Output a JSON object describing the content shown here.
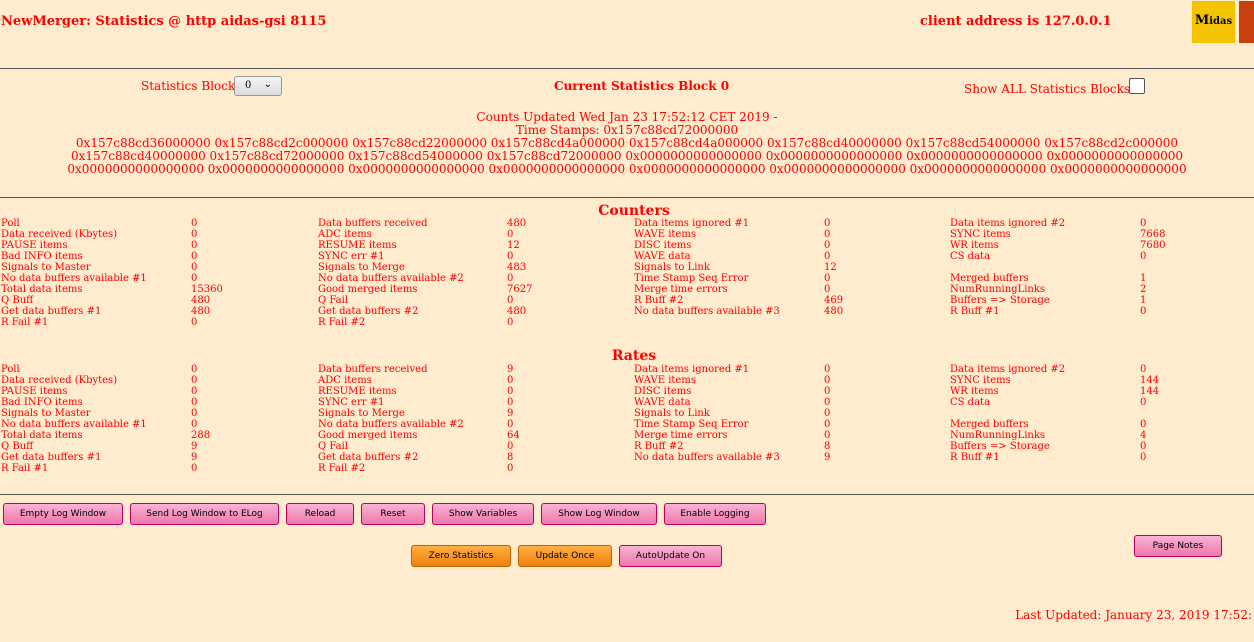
{
  "header": {
    "title": "NewMerger: Statistics @ http aidas-gsi 8115",
    "client": "client address is 127.0.0.1",
    "logo_text": "Midas"
  },
  "controls": {
    "block_label": "Statistics Block",
    "block_value": "0",
    "current": "Current Statistics Block 0",
    "show_all": "Show ALL Statistics Blocks?",
    "show_all_checked": false
  },
  "info": {
    "updated": "Counts Updated Wed Jan 23 17:52:12 CET 2019 -",
    "timestamps_label": "Time Stamps: 0x157c88cd72000000",
    "ts_lines": [
      "0x157c88cd36000000 0x157c88cd2c000000 0x157c88cd22000000 0x157c88cd4a000000 0x157c88cd4a000000 0x157c88cd40000000 0x157c88cd54000000 0x157c88cd2c000000",
      "0x157c88cd40000000 0x157c88cd72000000 0x157c88cd54000000 0x157c88cd72000000 0x0000000000000000 0x0000000000000000 0x0000000000000000 0x0000000000000000",
      "0x0000000000000000 0x0000000000000000 0x0000000000000000 0x0000000000000000 0x0000000000000000 0x0000000000000000 0x0000000000000000 0x0000000000000000"
    ]
  },
  "counters": {
    "title": "Counters",
    "rows": [
      [
        "Poll",
        "0",
        "Data buffers received",
        "480",
        "Data items ignored #1",
        "0",
        "Data items ignored #2",
        "0"
      ],
      [
        "Data received (Kbytes)",
        "0",
        "ADC items",
        "0",
        "WAVE items",
        "0",
        "SYNC items",
        "7668"
      ],
      [
        "PAUSE items",
        "0",
        "RESUME items",
        "12",
        "DISC items",
        "0",
        "WR items",
        "7680"
      ],
      [
        "Bad INFO items",
        "0",
        "SYNC err #1",
        "0",
        "WAVE data",
        "0",
        "CS data",
        "0"
      ],
      [
        "Signals to Master",
        "0",
        "Signals to Merge",
        "483",
        "Signals to Link",
        "12",
        "",
        ""
      ],
      [
        "No data buffers available #1",
        "0",
        "No data buffers available #2",
        "0",
        "Time Stamp Seq Error",
        "0",
        "Merged buffers",
        "1"
      ],
      [
        "Total data items",
        "15360",
        "Good merged items",
        "7627",
        "Merge time errors",
        "0",
        "NumRunningLinks",
        "2"
      ],
      [
        "Q Buff",
        "480",
        "Q Fail",
        "0",
        "R Buff #2",
        "469",
        "Buffers => Storage",
        "1"
      ],
      [
        "Get data buffers #1",
        "480",
        "Get data buffers #2",
        "480",
        "No data buffers available #3",
        "480",
        "R Buff #1",
        "0"
      ],
      [
        "R Fail #1",
        "0",
        "R Fail #2",
        "0",
        "",
        "",
        "",
        ""
      ]
    ]
  },
  "rates": {
    "title": "Rates",
    "rows": [
      [
        "Poll",
        "0",
        "Data buffers received",
        "9",
        "Data items ignored #1",
        "0",
        "Data items ignored #2",
        "0"
      ],
      [
        "Data received (Kbytes)",
        "0",
        "ADC items",
        "0",
        "WAVE items",
        "0",
        "SYNC items",
        "144"
      ],
      [
        "PAUSE items",
        "0",
        "RESUME items",
        "0",
        "DISC items",
        "0",
        "WR items",
        "144"
      ],
      [
        "Bad INFO items",
        "0",
        "SYNC err #1",
        "0",
        "WAVE data",
        "0",
        "CS data",
        "0"
      ],
      [
        "Signals to Master",
        "0",
        "Signals to Merge",
        "9",
        "Signals to Link",
        "0",
        "",
        ""
      ],
      [
        "No data buffers available #1",
        "0",
        "No data buffers available #2",
        "0",
        "Time Stamp Seq Error",
        "0",
        "Merged buffers",
        "0"
      ],
      [
        "Total data items",
        "288",
        "Good merged items",
        "64",
        "Merge time errors",
        "0",
        "NumRunningLinks",
        "4"
      ],
      [
        "Q Buff",
        "9",
        "Q Fail",
        "0",
        "R Buff #2",
        "8",
        "Buffers => Storage",
        "0"
      ],
      [
        "Get data buffers #1",
        "9",
        "Get data buffers #2",
        "8",
        "No data buffers available #3",
        "9",
        "R Buff #1",
        "0"
      ],
      [
        "R Fail #1",
        "0",
        "R Fail #2",
        "0",
        "",
        "",
        "",
        ""
      ]
    ]
  },
  "buttons": {
    "empty_log": "Empty Log Window",
    "send_log": "Send Log Window to ELog",
    "reload": "Reload",
    "reset": "Reset",
    "show_vars": "Show Variables",
    "show_log": "Show Log Window",
    "enable_logging": "Enable Logging",
    "zero": "Zero Statistics",
    "update_once": "Update Once",
    "autoupdate": "AutoUpdate On",
    "page_notes": "Page Notes"
  },
  "footer": {
    "last_updated": "Last Updated: January 23, 2019 17:52:"
  }
}
